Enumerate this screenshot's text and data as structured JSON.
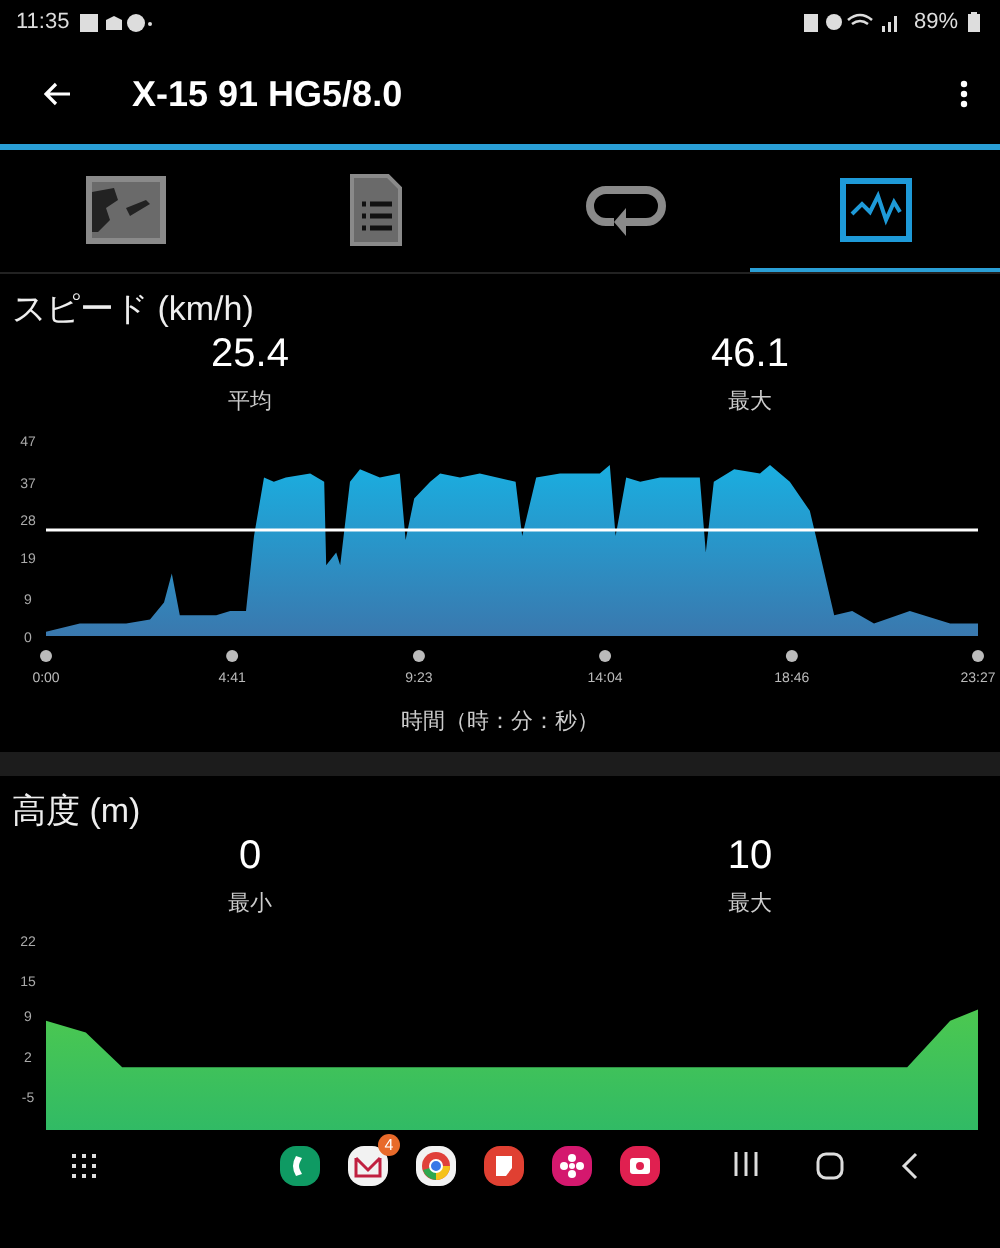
{
  "status_bar": {
    "time": "11:35",
    "battery": "89%"
  },
  "app_bar": {
    "title": "X-15 91 HG5/8.0"
  },
  "tabs": [
    {
      "kind": "map",
      "selected": false
    },
    {
      "kind": "details",
      "selected": false
    },
    {
      "kind": "laps",
      "selected": false
    },
    {
      "kind": "graph",
      "selected": true
    }
  ],
  "speed": {
    "title": "スピード (km/h)",
    "stats": [
      {
        "value": "25.4",
        "label": "平均"
      },
      {
        "value": "46.1",
        "label": "最大"
      }
    ],
    "chart_data": {
      "type": "area",
      "xlabel": "時間（時：分：秒）",
      "xlim": [
        0,
        1407
      ],
      "ylim": [
        0,
        47
      ],
      "yticks": [
        0,
        9,
        19,
        28,
        37,
        47
      ],
      "xticks": [
        {
          "value": 0,
          "label": "0:00"
        },
        {
          "value": 281,
          "label": "4:41"
        },
        {
          "value": 563,
          "label": "9:23"
        },
        {
          "value": 844,
          "label": "14:04"
        },
        {
          "value": 1126,
          "label": "18:46"
        },
        {
          "value": 1407,
          "label": "23:27"
        }
      ],
      "x": [
        0,
        51,
        121,
        157,
        178,
        190,
        202,
        257,
        278,
        302,
        314,
        329,
        344,
        362,
        399,
        420,
        423,
        438,
        444,
        459,
        474,
        504,
        534,
        543,
        556,
        580,
        595,
        625,
        655,
        709,
        719,
        740,
        776,
        836,
        851,
        860,
        876,
        897,
        927,
        987,
        996,
        1008,
        1039,
        1078,
        1093,
        1123,
        1153,
        1162,
        1190,
        1217,
        1250,
        1304,
        1365,
        1407
      ],
      "series": [
        {
          "color": "#1aaee0",
          "values": [
            1,
            3,
            3,
            4,
            8,
            15,
            5,
            5,
            6,
            6,
            24,
            38,
            37,
            38,
            39,
            37,
            17,
            20,
            17,
            37,
            40,
            38,
            39,
            23,
            33,
            37,
            39,
            38,
            39,
            37,
            24,
            38,
            39,
            39,
            41,
            24,
            38,
            37,
            38,
            38,
            20,
            37,
            40,
            39,
            41,
            37,
            30,
            24,
            5,
            6,
            3,
            6,
            3,
            3
          ]
        }
      ],
      "ref_lines": [
        {
          "axis": "y",
          "value": 25.4
        }
      ]
    }
  },
  "altitude": {
    "title": "高度 (m)",
    "stats": [
      {
        "value": "0",
        "label": "最小"
      },
      {
        "value": "10",
        "label": "最大"
      }
    ],
    "chart_data": {
      "type": "area",
      "xlim": [
        0,
        1407
      ],
      "ylim": [
        -5,
        22
      ],
      "yticks": [
        -5,
        2,
        9,
        15,
        22
      ],
      "x": [
        0,
        60,
        115,
        1300,
        1365,
        1407
      ],
      "series": [
        {
          "color": "#4cc850",
          "values": [
            8,
            6,
            0,
            0,
            8,
            10
          ]
        }
      ]
    }
  },
  "dock": [
    {
      "kind": "phone"
    },
    {
      "kind": "mail",
      "badge": "4"
    },
    {
      "kind": "browser"
    },
    {
      "kind": "notes"
    },
    {
      "kind": "flower"
    },
    {
      "kind": "camera"
    }
  ]
}
